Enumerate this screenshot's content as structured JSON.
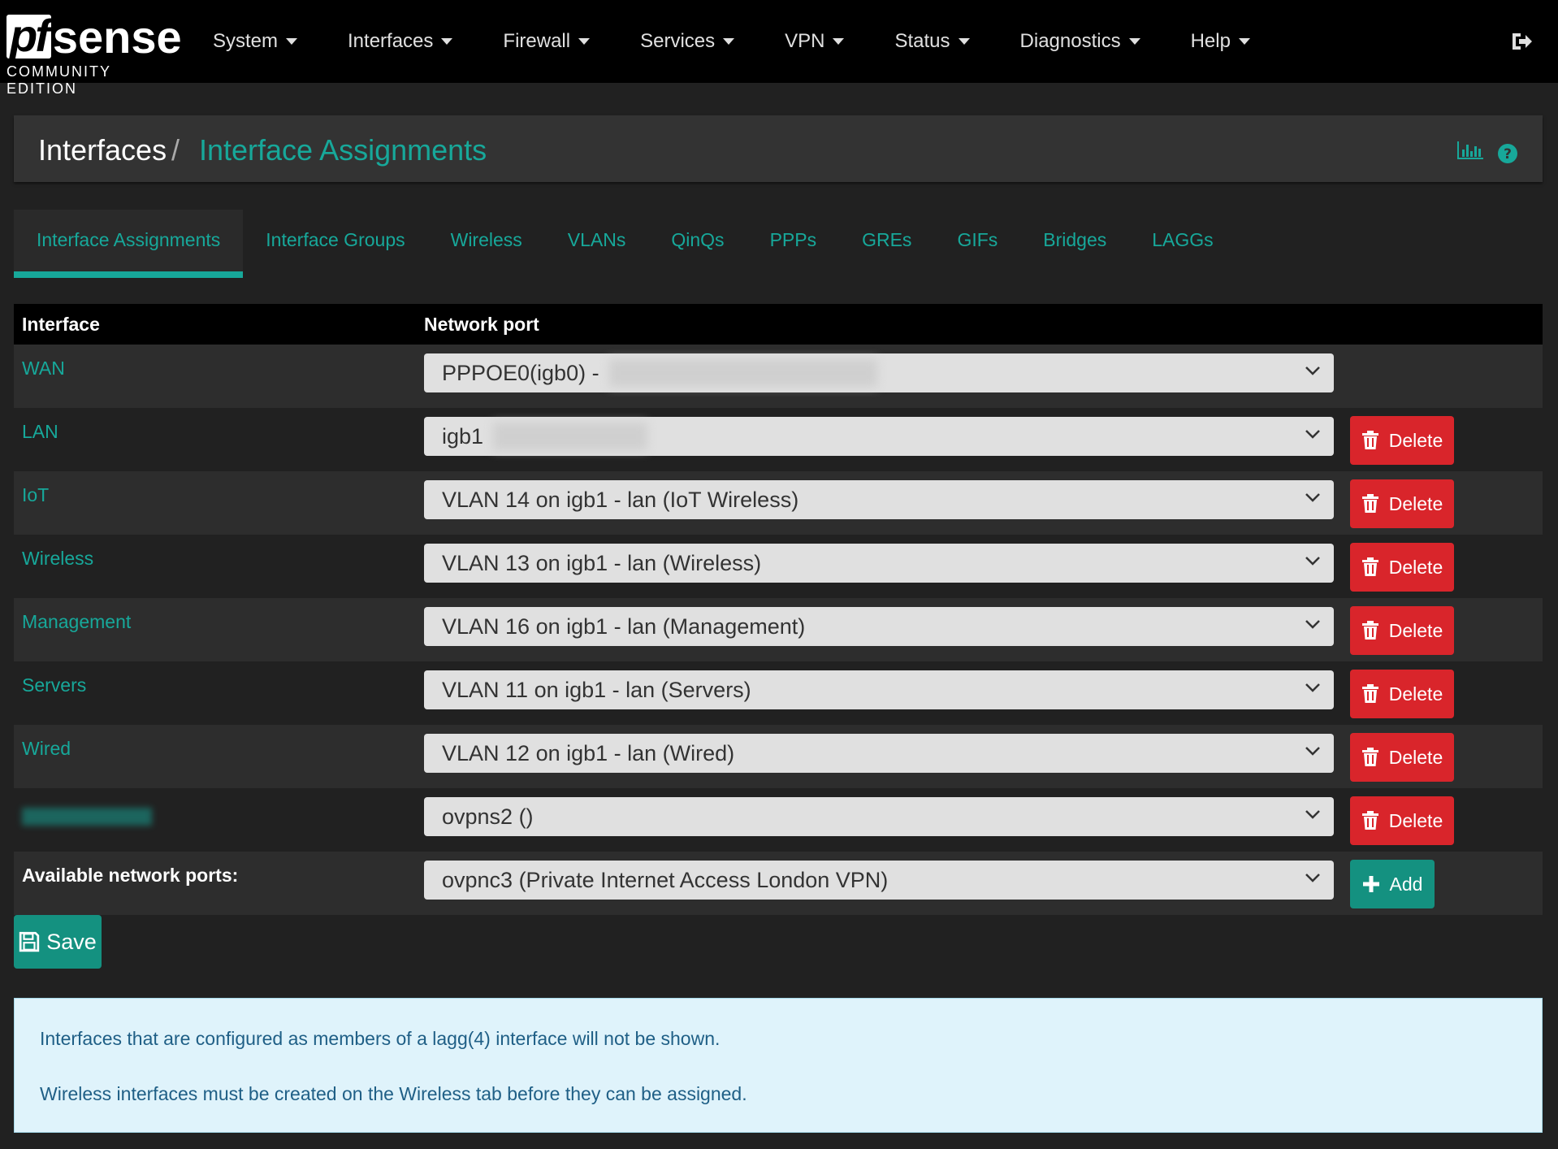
{
  "brand": {
    "logo_pf": "pf",
    "logo_sense": "sense",
    "edition": "COMMUNITY EDITION"
  },
  "nav": {
    "items": [
      {
        "label": "System"
      },
      {
        "label": "Interfaces"
      },
      {
        "label": "Firewall"
      },
      {
        "label": "Services"
      },
      {
        "label": "VPN"
      },
      {
        "label": "Status"
      },
      {
        "label": "Diagnostics"
      },
      {
        "label": "Help"
      }
    ],
    "logout_icon": "sign-out-icon"
  },
  "header": {
    "crumb_parent": "Interfaces",
    "crumb_separator": "/",
    "crumb_current": "Interface Assignments",
    "icons": [
      "bar-chart-icon",
      "help-circle-icon"
    ]
  },
  "tabs": [
    {
      "label": "Interface Assignments",
      "active": true
    },
    {
      "label": "Interface Groups"
    },
    {
      "label": "Wireless"
    },
    {
      "label": "VLANs"
    },
    {
      "label": "QinQs"
    },
    {
      "label": "PPPs"
    },
    {
      "label": "GREs"
    },
    {
      "label": "GIFs"
    },
    {
      "label": "Bridges"
    },
    {
      "label": "LAGGs"
    }
  ],
  "table": {
    "headers": {
      "interface": "Interface",
      "network_port": "Network port"
    },
    "rows": [
      {
        "interface": "WAN",
        "port": "PPPOE0(igb0) -"
      },
      {
        "interface": "LAN",
        "port": "igb1"
      },
      {
        "interface": "IoT",
        "port": "VLAN 14 on igb1 - lan (IoT Wireless)"
      },
      {
        "interface": "Wireless",
        "port": "VLAN 13 on igb1 - lan (Wireless)"
      },
      {
        "interface": "Management",
        "port": "VLAN 16 on igb1 - lan (Management)"
      },
      {
        "interface": "Servers",
        "port": "VLAN 11 on igb1 - lan (Servers)"
      },
      {
        "interface": "Wired",
        "port": "VLAN 12 on igb1 - lan (Wired)"
      },
      {
        "interface": "",
        "port": "ovpns2 ()"
      }
    ],
    "delete_label": "Delete",
    "available": {
      "label": "Available network ports:",
      "port": "ovpnc3 (Private Internet Access London VPN)",
      "add_label": "Add"
    }
  },
  "save_label": "Save",
  "info": {
    "line1": "Interfaces that are configured as members of a lagg(4) interface will not be shown.",
    "line2": "Wireless interfaces must be created on the Wireless tab before they can be assigned."
  },
  "colors": {
    "accent": "#17a89a",
    "danger": "#d9252b",
    "success": "#149180",
    "background": "#212121",
    "navbar": "#000000"
  }
}
